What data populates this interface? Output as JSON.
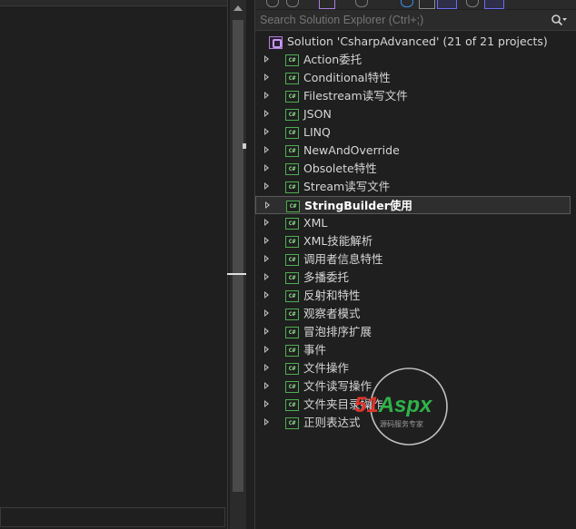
{
  "search": {
    "placeholder": "Search Solution Explorer (Ctrl+;)"
  },
  "solution": {
    "label": "Solution 'CsharpAdvanced' (21 of 21 projects)"
  },
  "projects": [
    {
      "label": "Action委托"
    },
    {
      "label": "Conditional特性"
    },
    {
      "label": "Filestream读写文件"
    },
    {
      "label": "JSON"
    },
    {
      "label": "LINQ"
    },
    {
      "label": "NewAndOverride"
    },
    {
      "label": "Obsolete特性"
    },
    {
      "label": "Stream读写文件"
    },
    {
      "label": "StringBuilder使用",
      "selected": true
    },
    {
      "label": "XML"
    },
    {
      "label": "XML技能解析"
    },
    {
      "label": "调用者信息特性"
    },
    {
      "label": "多播委托"
    },
    {
      "label": "反射和特性"
    },
    {
      "label": "观察者模式"
    },
    {
      "label": "冒泡排序扩展"
    },
    {
      "label": "事件"
    },
    {
      "label": "文件操作"
    },
    {
      "label": "文件读写操作"
    },
    {
      "label": "文件夹目录操作"
    },
    {
      "label": "正则表达式"
    }
  ],
  "project_icon_text": "C#",
  "watermark": {
    "text": "51Aspx",
    "subtext": "源码服务专家"
  },
  "colors": {
    "accent": "#6c6cf0",
    "project_icon": "#4caf50",
    "solution_icon": "#b180d7",
    "watermark_red": "#e0342a",
    "watermark_green": "#2fb34a"
  }
}
